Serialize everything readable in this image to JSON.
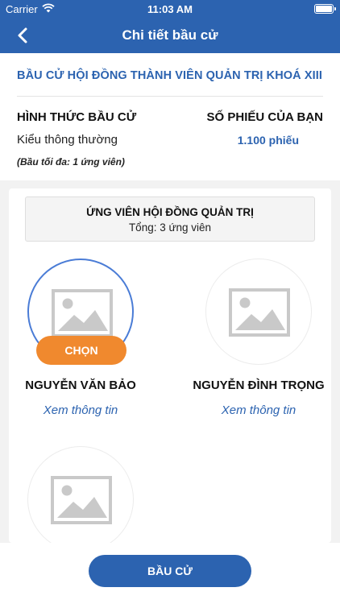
{
  "status_bar": {
    "carrier": "Carrier",
    "time": "11:03 AM"
  },
  "nav": {
    "title": "Chi tiết bầu cử"
  },
  "election": {
    "title": "BẦU CỬ HỘI ĐỒNG THÀNH VIÊN QUẢN TRỊ KHOÁ XIII",
    "form_heading": "HÌNH THỨC BẦU CỬ",
    "form_value": "Kiểu thông thường",
    "form_note": "(Bầu tối đa: 1 ứng viên)",
    "votes_heading": "SỐ PHIẾU CỦA BẠN",
    "votes_value": "1.100 phiếu"
  },
  "candidates_panel": {
    "heading": "ỨNG VIÊN HỘI ĐỒNG QUẢN TRỊ",
    "total": "Tổng: 3 ứng viên",
    "choose_label": "CHỌN",
    "view_label": "Xem thông tin",
    "candidates": [
      {
        "name": "NGUYỄN VĂN BẢO",
        "selected": true
      },
      {
        "name": "NGUYỄN ĐÌNH TRỌNG",
        "selected": false
      },
      {
        "name": "",
        "selected": false
      }
    ]
  },
  "footer": {
    "vote_label": "BẦU CỬ"
  },
  "colors": {
    "primary": "#2c63b0",
    "accent": "#f0892e",
    "selected_ring": "#4a7cd6"
  },
  "icons": [
    "wifi-icon",
    "battery-icon",
    "back-chevron-icon",
    "image-placeholder-icon"
  ]
}
